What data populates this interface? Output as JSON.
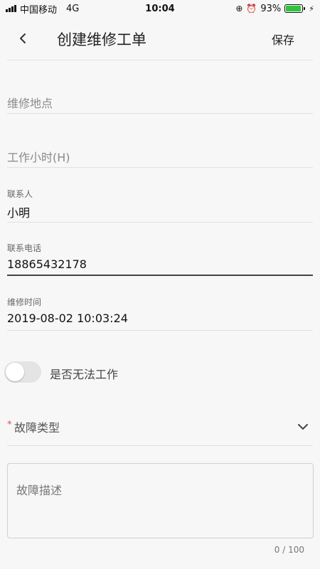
{
  "status_bar": {
    "carrier": "中国移动",
    "network": "4G",
    "time": "10:04",
    "battery_percent": "93%",
    "battery_level": 0.93,
    "icons": [
      "signal-icon",
      "lock-rotation-icon",
      "alarm-icon",
      "battery-icon",
      "charging-icon"
    ]
  },
  "nav": {
    "title": "创建维修工单",
    "save_label": "保存",
    "back_icon": "back-chevron-icon"
  },
  "form": {
    "location": {
      "placeholder": "维修地点"
    },
    "work_hours": {
      "placeholder": "工作小时(H)"
    },
    "contact": {
      "label": "联系人",
      "value": "小明"
    },
    "phone": {
      "label": "联系电话",
      "value": "18865432178"
    },
    "repair_time": {
      "label": "维修时间",
      "value": "2019-08-02 10:03:24"
    },
    "cannot_work": {
      "label": "是否无法工作",
      "checked": false
    },
    "fault_type": {
      "required_mark": "*",
      "label": "故障类型"
    },
    "fault_description": {
      "placeholder": "故障描述",
      "count": "0 / 100"
    }
  },
  "colors": {
    "background": "#f7f7f7",
    "battery_green": "#2fc43b",
    "required_red": "#d9534f",
    "toggle_off": "#e4e4e4"
  }
}
